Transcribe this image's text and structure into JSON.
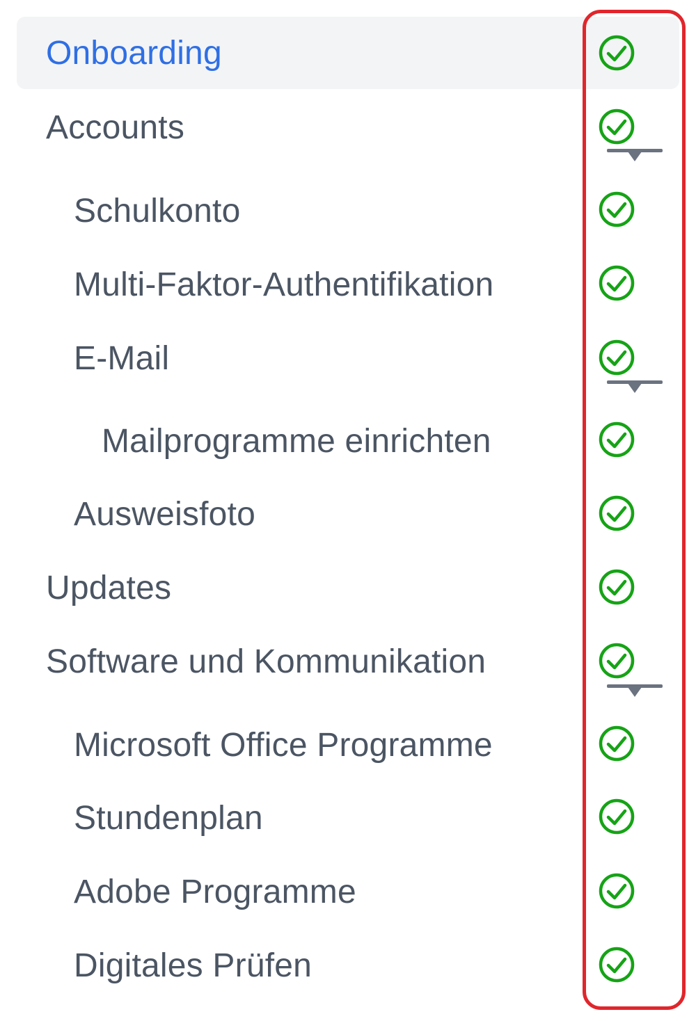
{
  "colors": {
    "active_text": "#2f6fe4",
    "text": "#4b5563",
    "active_background": "#f3f4f6",
    "status_check": "#16a316",
    "caret": "#6b7280",
    "highlight_box": "#e0262c"
  },
  "nav": {
    "items": [
      {
        "label": "Onboarding",
        "level": 0,
        "active": true,
        "status_icon": "check-circle-icon"
      },
      {
        "label": "Accounts",
        "level": 0,
        "expanded": true,
        "status_icon": "check-circle-icon"
      },
      {
        "label": "Schulkonto",
        "level": 1,
        "status_icon": "check-circle-icon"
      },
      {
        "label": "Multi-Faktor-Authentifikation",
        "level": 1,
        "status_icon": "check-circle-icon"
      },
      {
        "label": "E-Mail",
        "level": 1,
        "expanded": true,
        "status_icon": "check-circle-icon"
      },
      {
        "label": "Mailprogramme einrichten",
        "level": 2,
        "status_icon": "check-circle-icon"
      },
      {
        "label": "Ausweisfoto",
        "level": 1,
        "status_icon": "check-circle-icon"
      },
      {
        "label": "Updates",
        "level": 0,
        "status_icon": "check-circle-icon"
      },
      {
        "label": "Software und Kommunikation",
        "level": 0,
        "expanded": true,
        "status_icon": "check-circle-icon"
      },
      {
        "label": "Microsoft Office Programme",
        "level": 1,
        "status_icon": "check-circle-icon"
      },
      {
        "label": "Stundenplan",
        "level": 1,
        "status_icon": "check-circle-icon"
      },
      {
        "label": "Adobe Programme",
        "level": 1,
        "status_icon": "check-circle-icon"
      },
      {
        "label": "Digitales Prüfen",
        "level": 1,
        "status_icon": "check-circle-icon"
      }
    ]
  }
}
